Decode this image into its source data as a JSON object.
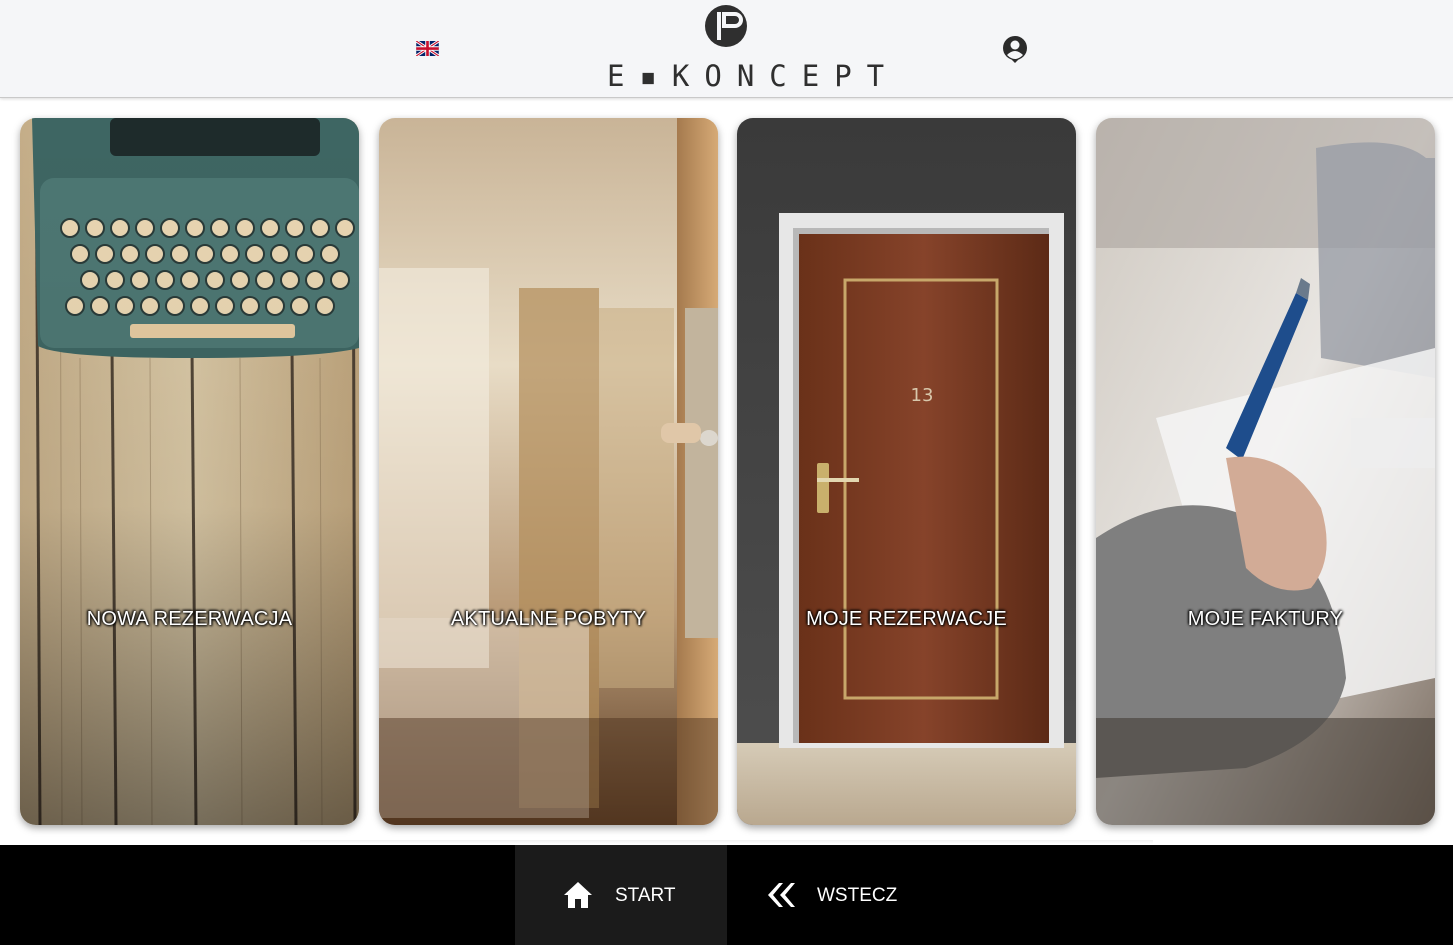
{
  "header": {
    "language_flag": "uk-flag-icon",
    "logo_text": "E▪KONCEPT",
    "user_icon": "user-account-icon"
  },
  "tiles": [
    {
      "label": "NOWA REZERWACJA",
      "image": "typewriter-on-wood"
    },
    {
      "label": "AKTUALNE POBYTY",
      "image": "hotel-room-door"
    },
    {
      "label": "MOJE REZERWACJE",
      "image": "wooden-door-13",
      "door_number": "13"
    },
    {
      "label": "MOJE FAKTURY",
      "image": "hand-writing-pen"
    }
  ],
  "footer": {
    "start_label": "START",
    "back_label": "WSTECZ",
    "start_icon": "home-icon",
    "back_icon": "double-chevron-left-icon"
  },
  "colors": {
    "header_bg": "#f5f6f8",
    "footer_bg": "#000000",
    "footer_active_bg": "#1b1b1b",
    "logo_text": "#2f2f2f"
  }
}
